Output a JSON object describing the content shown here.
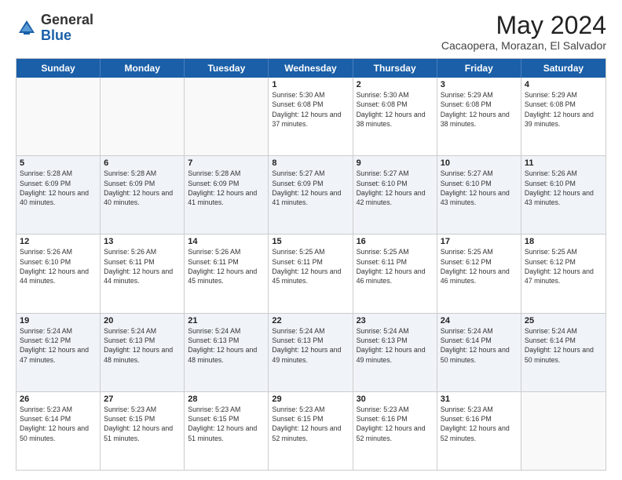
{
  "header": {
    "logo_general": "General",
    "logo_blue": "Blue",
    "month_title": "May 2024",
    "location": "Cacaopera, Morazan, El Salvador"
  },
  "weekdays": [
    "Sunday",
    "Monday",
    "Tuesday",
    "Wednesday",
    "Thursday",
    "Friday",
    "Saturday"
  ],
  "rows": [
    [
      {
        "date": "",
        "info": ""
      },
      {
        "date": "",
        "info": ""
      },
      {
        "date": "",
        "info": ""
      },
      {
        "date": "1",
        "info": "Sunrise: 5:30 AM\nSunset: 6:08 PM\nDaylight: 12 hours and 37 minutes."
      },
      {
        "date": "2",
        "info": "Sunrise: 5:30 AM\nSunset: 6:08 PM\nDaylight: 12 hours and 38 minutes."
      },
      {
        "date": "3",
        "info": "Sunrise: 5:29 AM\nSunset: 6:08 PM\nDaylight: 12 hours and 38 minutes."
      },
      {
        "date": "4",
        "info": "Sunrise: 5:29 AM\nSunset: 6:08 PM\nDaylight: 12 hours and 39 minutes."
      }
    ],
    [
      {
        "date": "5",
        "info": "Sunrise: 5:28 AM\nSunset: 6:09 PM\nDaylight: 12 hours and 40 minutes."
      },
      {
        "date": "6",
        "info": "Sunrise: 5:28 AM\nSunset: 6:09 PM\nDaylight: 12 hours and 40 minutes."
      },
      {
        "date": "7",
        "info": "Sunrise: 5:28 AM\nSunset: 6:09 PM\nDaylight: 12 hours and 41 minutes."
      },
      {
        "date": "8",
        "info": "Sunrise: 5:27 AM\nSunset: 6:09 PM\nDaylight: 12 hours and 41 minutes."
      },
      {
        "date": "9",
        "info": "Sunrise: 5:27 AM\nSunset: 6:10 PM\nDaylight: 12 hours and 42 minutes."
      },
      {
        "date": "10",
        "info": "Sunrise: 5:27 AM\nSunset: 6:10 PM\nDaylight: 12 hours and 43 minutes."
      },
      {
        "date": "11",
        "info": "Sunrise: 5:26 AM\nSunset: 6:10 PM\nDaylight: 12 hours and 43 minutes."
      }
    ],
    [
      {
        "date": "12",
        "info": "Sunrise: 5:26 AM\nSunset: 6:10 PM\nDaylight: 12 hours and 44 minutes."
      },
      {
        "date": "13",
        "info": "Sunrise: 5:26 AM\nSunset: 6:11 PM\nDaylight: 12 hours and 44 minutes."
      },
      {
        "date": "14",
        "info": "Sunrise: 5:26 AM\nSunset: 6:11 PM\nDaylight: 12 hours and 45 minutes."
      },
      {
        "date": "15",
        "info": "Sunrise: 5:25 AM\nSunset: 6:11 PM\nDaylight: 12 hours and 45 minutes."
      },
      {
        "date": "16",
        "info": "Sunrise: 5:25 AM\nSunset: 6:11 PM\nDaylight: 12 hours and 46 minutes."
      },
      {
        "date": "17",
        "info": "Sunrise: 5:25 AM\nSunset: 6:12 PM\nDaylight: 12 hours and 46 minutes."
      },
      {
        "date": "18",
        "info": "Sunrise: 5:25 AM\nSunset: 6:12 PM\nDaylight: 12 hours and 47 minutes."
      }
    ],
    [
      {
        "date": "19",
        "info": "Sunrise: 5:24 AM\nSunset: 6:12 PM\nDaylight: 12 hours and 47 minutes."
      },
      {
        "date": "20",
        "info": "Sunrise: 5:24 AM\nSunset: 6:13 PM\nDaylight: 12 hours and 48 minutes."
      },
      {
        "date": "21",
        "info": "Sunrise: 5:24 AM\nSunset: 6:13 PM\nDaylight: 12 hours and 48 minutes."
      },
      {
        "date": "22",
        "info": "Sunrise: 5:24 AM\nSunset: 6:13 PM\nDaylight: 12 hours and 49 minutes."
      },
      {
        "date": "23",
        "info": "Sunrise: 5:24 AM\nSunset: 6:13 PM\nDaylight: 12 hours and 49 minutes."
      },
      {
        "date": "24",
        "info": "Sunrise: 5:24 AM\nSunset: 6:14 PM\nDaylight: 12 hours and 50 minutes."
      },
      {
        "date": "25",
        "info": "Sunrise: 5:24 AM\nSunset: 6:14 PM\nDaylight: 12 hours and 50 minutes."
      }
    ],
    [
      {
        "date": "26",
        "info": "Sunrise: 5:23 AM\nSunset: 6:14 PM\nDaylight: 12 hours and 50 minutes."
      },
      {
        "date": "27",
        "info": "Sunrise: 5:23 AM\nSunset: 6:15 PM\nDaylight: 12 hours and 51 minutes."
      },
      {
        "date": "28",
        "info": "Sunrise: 5:23 AM\nSunset: 6:15 PM\nDaylight: 12 hours and 51 minutes."
      },
      {
        "date": "29",
        "info": "Sunrise: 5:23 AM\nSunset: 6:15 PM\nDaylight: 12 hours and 52 minutes."
      },
      {
        "date": "30",
        "info": "Sunrise: 5:23 AM\nSunset: 6:16 PM\nDaylight: 12 hours and 52 minutes."
      },
      {
        "date": "31",
        "info": "Sunrise: 5:23 AM\nSunset: 6:16 PM\nDaylight: 12 hours and 52 minutes."
      },
      {
        "date": "",
        "info": ""
      }
    ]
  ]
}
